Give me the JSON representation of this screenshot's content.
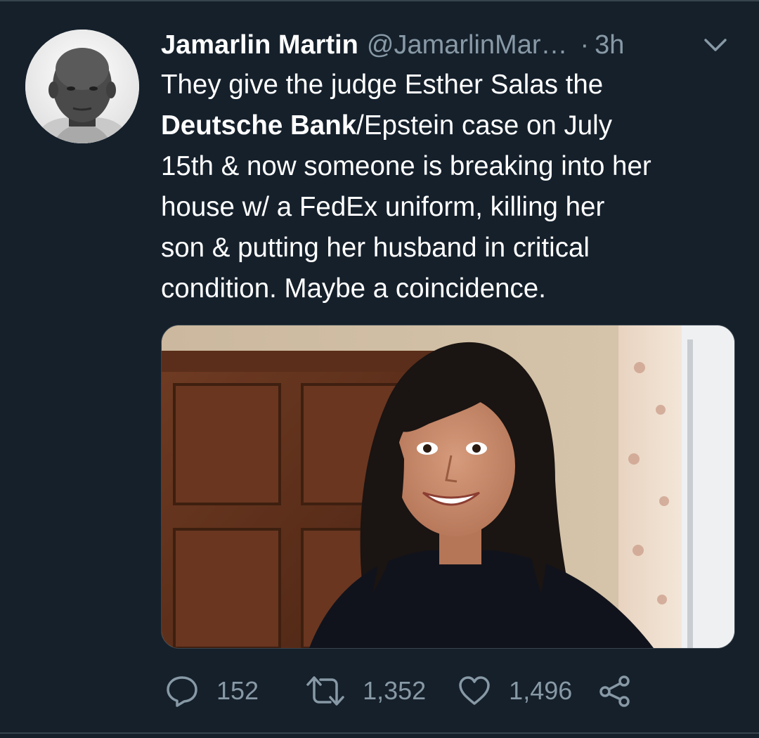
{
  "tweet": {
    "author": {
      "display_name": "Jamarlin Martin",
      "handle": "@JamarlinMar…",
      "avatar": "author-avatar"
    },
    "separator": "·",
    "time": "3h",
    "menu_icon": "chevron-down-icon",
    "text": {
      "line1": "They give the judge Esther Salas the",
      "line2_bold": "Deutsche Bank",
      "line2_rest": "/Epstein case on July",
      "line3": "15th & now someone is breaking into her",
      "line4": "house w/ a FedEx uniform, killing her",
      "line5": "son & putting her husband in critical",
      "line6": "condition. Maybe a coincidence."
    },
    "media": {
      "type": "photo"
    },
    "actions": {
      "reply": {
        "icon": "reply-icon",
        "count": "152"
      },
      "retweet": {
        "icon": "retweet-icon",
        "count": "1,352"
      },
      "like": {
        "icon": "heart-icon",
        "count": "1,496"
      },
      "share": {
        "icon": "share-icon"
      }
    }
  },
  "colors": {
    "background": "#15202b",
    "text": "#ffffff",
    "secondary": "#8899a6",
    "border": "#38444d"
  }
}
